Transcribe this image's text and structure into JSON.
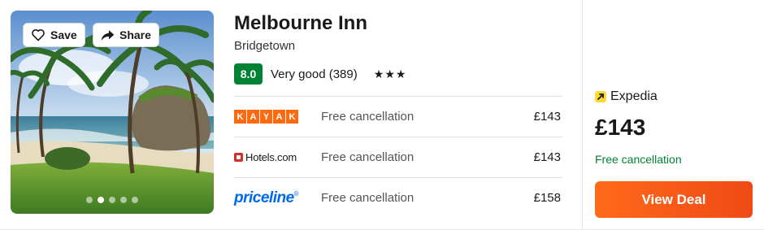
{
  "hotel": {
    "name": "Melbourne Inn",
    "location": "Bridgetown",
    "score": "8.0",
    "rating_label": "Very good (389)",
    "stars": 3
  },
  "photo": {
    "save_label": "Save",
    "share_label": "Share",
    "image_count": 5,
    "active_image": 2
  },
  "offers": [
    {
      "provider": "KAYAK",
      "cancellation": "Free cancellation",
      "price": "£143"
    },
    {
      "provider": "Hotels.com",
      "cancellation": "Free cancellation",
      "price": "£143"
    },
    {
      "provider": "priceline",
      "cancellation": "Free cancellation",
      "price": "£158"
    }
  ],
  "deal": {
    "provider": "Expedia",
    "price": "£143",
    "cancellation": "Free cancellation",
    "button_label": "View Deal"
  },
  "colors": {
    "score_bg": "#008234",
    "deal_button": "#ff6a1a",
    "kayak": "#ff690f",
    "priceline": "#0068ef",
    "expedia_icon": "#fddb32"
  },
  "icons": {
    "save": "heart-icon",
    "share": "share-arrow-icon",
    "star": "star-icon",
    "expedia": "expedia-arrow-icon"
  }
}
